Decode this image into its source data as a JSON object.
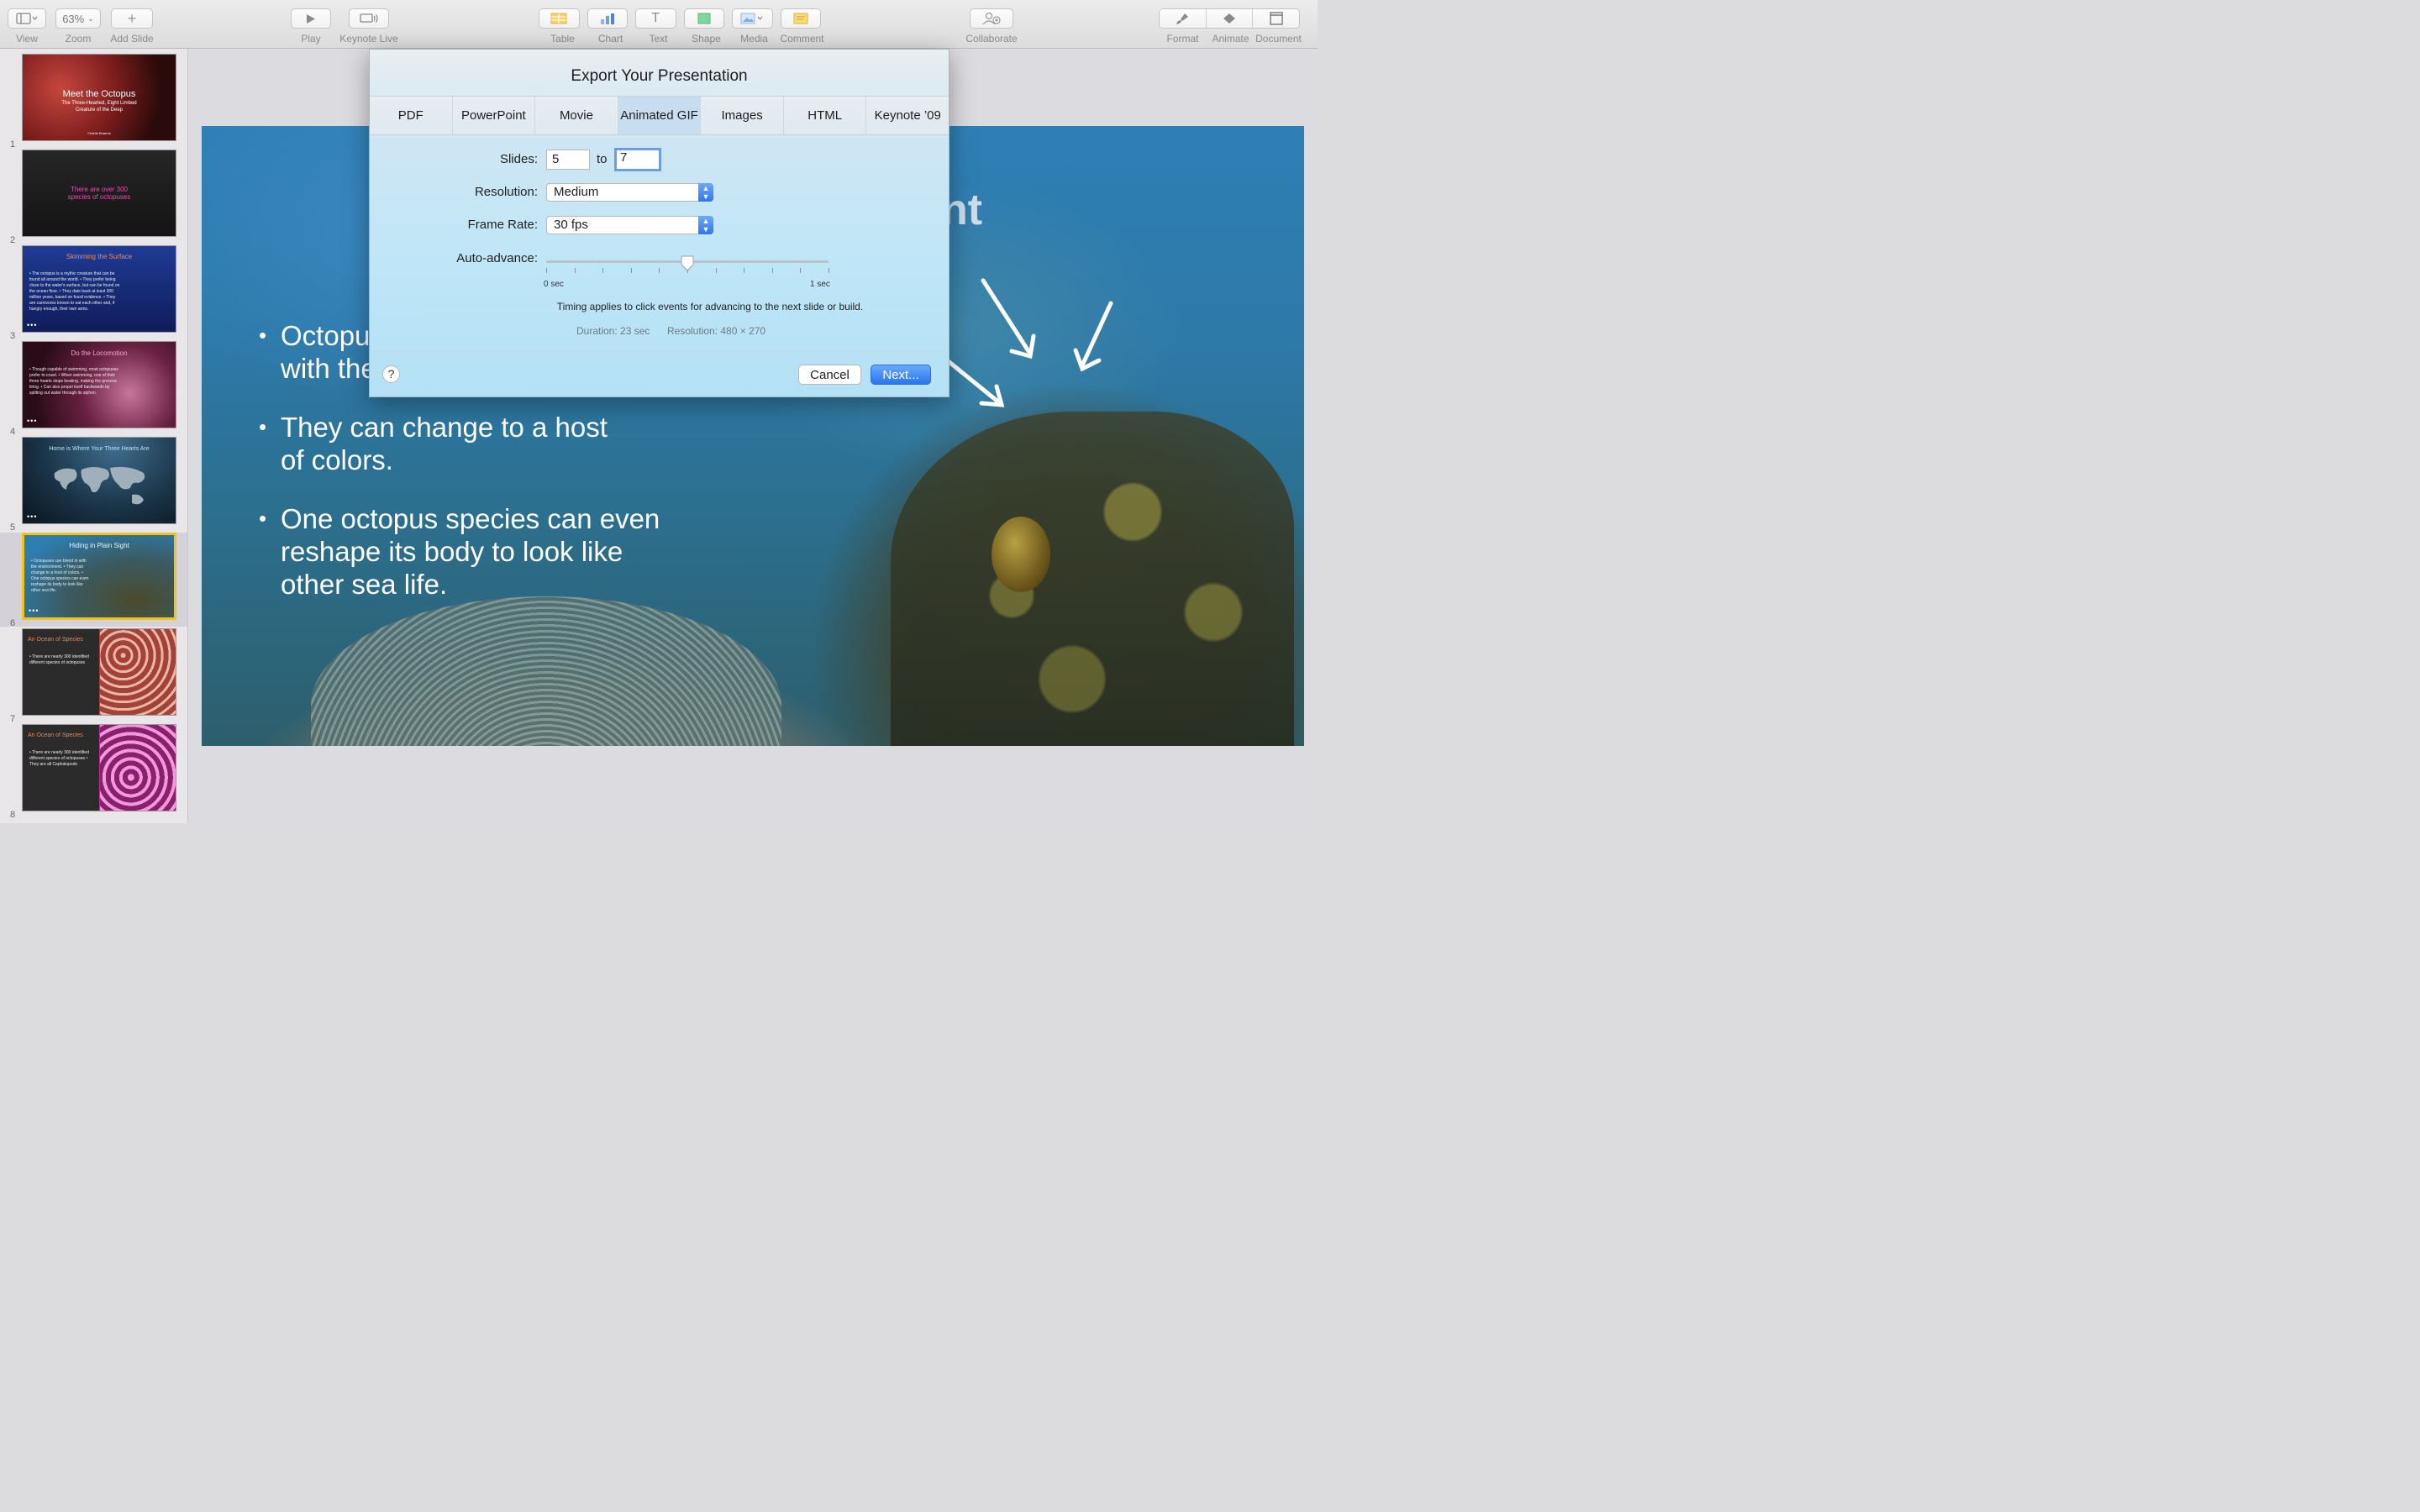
{
  "toolbar": {
    "view_label": "View",
    "zoom_value": "63%",
    "zoom_label": "Zoom",
    "add_slide_label": "Add Slide",
    "play_label": "Play",
    "keynote_live_label": "Keynote Live",
    "insert_labels": [
      "Table",
      "Chart",
      "Text",
      "Shape",
      "Media",
      "Comment"
    ],
    "collaborate_label": "Collaborate",
    "format_label": "Format",
    "animate_label": "Animate",
    "document_label": "Document"
  },
  "sidebar": {
    "slides": [
      {
        "num": "1",
        "title": "Meet the Octopus",
        "subtitle": "The Three-Hearted, Eight Limbed Creature of the Deep",
        "author": "Charlie Boarms"
      },
      {
        "num": "2",
        "title": "There are over 300 species of octopuses"
      },
      {
        "num": "3",
        "title": "Skimming the Surface",
        "body": "• The octopus is a mythic creature that can be found all around the world. • They prefer being close to the water's surface, but can be found on the ocean floor. • They date back at least 300 million years, based on fossil evidence. • They are carnivores known to eat each other and, if hungry enough, their own arms."
      },
      {
        "num": "4",
        "title": "Do the Locomotion",
        "body": "• Though capable of swimming, most octopuses prefer to crawl. • When swimming, one of their three hearts stops beating, making the process tiring. • Can also propel itself backwards by spitting out water through its siphon."
      },
      {
        "num": "5",
        "title": "Home is Where Your Three Hearts Are"
      },
      {
        "num": "6",
        "title": "Hiding in Plain Sight",
        "body": "• Octopuses can blend in with the environment. • They can change to a host of colors. • One octopus species can even reshape its body to look like other sea life."
      },
      {
        "num": "7",
        "title": "An Ocean of Species",
        "body": "• There are nearly 300 identified different species of octopuses"
      },
      {
        "num": "8",
        "title": "An Ocean of Species",
        "body": "• There are nearly 300 identified different species of octopuses • They are all Cephalopods"
      }
    ],
    "more_indicator": "•••"
  },
  "slide": {
    "title_fragment": "nt",
    "bullets": [
      "Octopuses can blend in with the",
      "They can change to a host of colors.",
      "One octopus species can even reshape its body to look like other sea life."
    ],
    "visible_bullet_1_line1": "Octopu",
    "visible_bullet_1_line2": "with the"
  },
  "dialog": {
    "title": "Export Your Presentation",
    "tabs": [
      "PDF",
      "PowerPoint",
      "Movie",
      "Animated GIF",
      "Images",
      "HTML",
      "Keynote ’09"
    ],
    "active_tab": "Animated GIF",
    "slides_label": "Slides:",
    "slides_from": "5",
    "to_label": "to",
    "slides_to": "7",
    "resolution_label": "Resolution:",
    "resolution_value": "Medium",
    "frame_rate_label": "Frame Rate:",
    "frame_rate_value": "30 fps",
    "auto_advance_label": "Auto-advance:",
    "slider_min_label": "0 sec",
    "slider_max_label": "1 sec",
    "auto_advance_fraction": 0.5,
    "timing_note": "Timing applies to click events for advancing to the next slide or build.",
    "duration_text": "Duration: 23 sec",
    "resolution_text": "Resolution: 480 × 270",
    "help_label": "?",
    "cancel_label": "Cancel",
    "next_label": "Next..."
  },
  "colors": {
    "accent": "#2a75ef",
    "selection": "#f0c419",
    "dialog_bg": "#bfe6f7"
  }
}
